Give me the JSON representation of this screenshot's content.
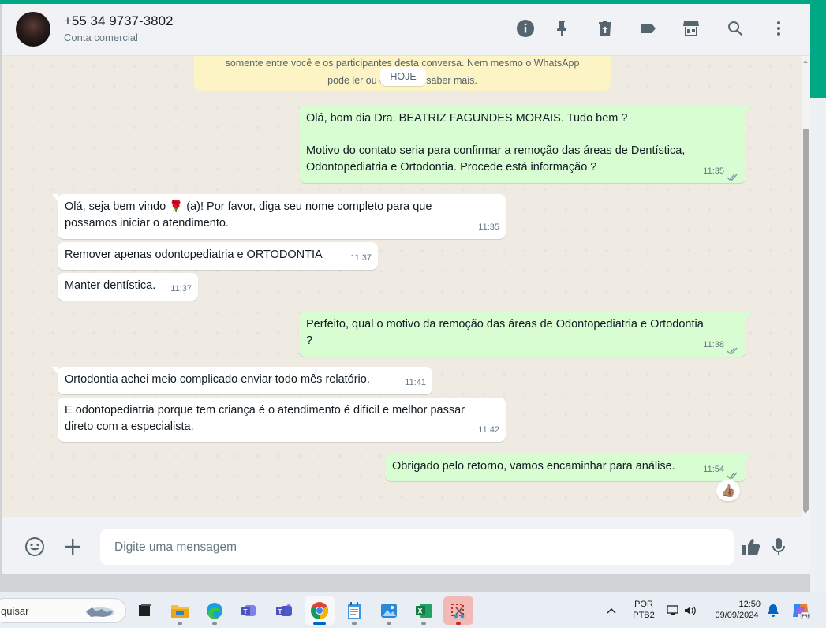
{
  "header": {
    "contact_name": "+55 34 9737-3802",
    "contact_subtitle": "Conta comercial",
    "icons": [
      "info-icon",
      "pin-icon",
      "delete-icon",
      "label-icon",
      "catalog-icon",
      "search-icon",
      "menu-icon"
    ]
  },
  "notice": {
    "line1": "somente entre você e os participantes desta conversa. Nem mesmo o WhatsApp",
    "line2": "pode ler ou ouvi-       para saber mais.",
    "date_chip": "HOJE"
  },
  "messages": [
    {
      "dir": "out",
      "line1": "Olá, bom dia Dra. BEATRIZ FAGUNDES MORAIS. Tudo bem ?",
      "line2": "Motivo do contato seria para confirmar a remoção das áreas de Dentística,",
      "line3": "Odontopediatria e Ortodontia. Procede está informação ?",
      "time": "11:35"
    },
    {
      "dir": "in",
      "line1a": "Olá, seja bem vindo",
      "emoji": "🌹",
      "line1b": "(a)! Por favor, diga seu nome completo para que",
      "line2": "possamos iniciar o atendimento.",
      "time": "11:35"
    },
    {
      "dir": "in",
      "text": "Remover apenas  odontopediatria e  ORTODONTIA",
      "time": "11:37"
    },
    {
      "dir": "in",
      "text": "Manter dentística.",
      "time": "11:37"
    },
    {
      "dir": "out",
      "line1": "Perfeito, qual o motivo da remoção das áreas de Odontopediatria e Ortodontia",
      "line2": "?",
      "time": "11:38"
    },
    {
      "dir": "in",
      "text": "Ortodontia achei meio complicado enviar todo mês relatório.",
      "time": "11:41"
    },
    {
      "dir": "in",
      "line1": "E odontopediatria porque tem criança é o atendimento é difícil e melhor passar",
      "line2": "direto com a especialista.",
      "time": "11:42"
    },
    {
      "dir": "out",
      "text": "Obrigado pelo retorno, vamos encaminhar para análise.",
      "time": "11:54",
      "reaction": "👍🏽"
    }
  ],
  "composer": {
    "placeholder": "Digite uma mensagem"
  },
  "taskbar": {
    "search_text": "quisar",
    "apps": [
      "task-view",
      "file-explorer",
      "edge",
      "teams",
      "teams-classic",
      "chrome",
      "notepad",
      "photos",
      "excel",
      "snipping-tool"
    ],
    "lang_line1": "POR",
    "lang_line2": "PTB2",
    "clock_time": "12:50",
    "clock_date": "09/09/2024"
  },
  "colors": {
    "accent": "#00a884",
    "outgoing_bubble": "#d9fdd3",
    "incoming_bubble": "#ffffff",
    "chat_bg": "#efeae2",
    "read_ticks": "#8696a0"
  }
}
